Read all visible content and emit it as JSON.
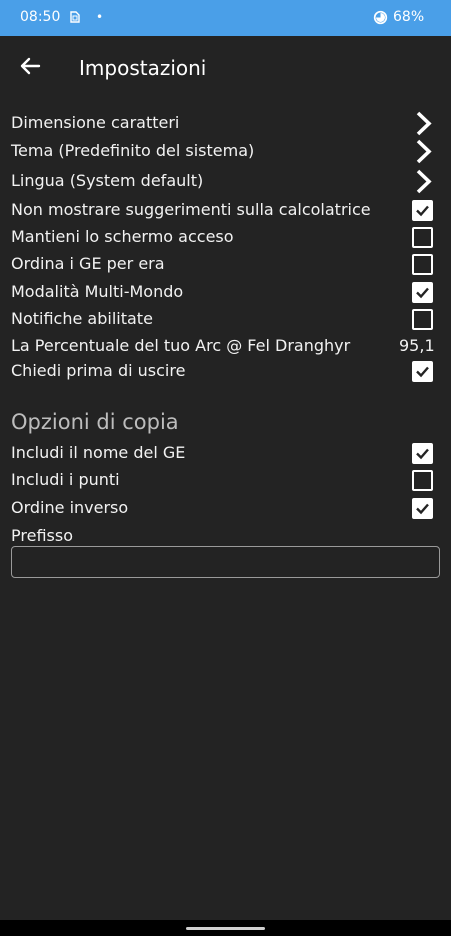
{
  "status_bar": {
    "time": "08:50",
    "dot": "•",
    "battery": "68%"
  },
  "app_bar": {
    "title": "Impostazioni",
    "back_icon": "arrow-left-icon"
  },
  "settings": [
    {
      "label": "Dimensione caratteri",
      "control": "chevron"
    },
    {
      "label": "Tema (Predefinito del sistema)",
      "control": "chevron"
    },
    {
      "label": "Lingua (System default)",
      "control": "chevron"
    },
    {
      "label": "Non mostrare suggerimenti sulla calcolatrice",
      "control": "checkbox",
      "checked": true
    },
    {
      "label": "Mantieni lo schermo acceso",
      "control": "checkbox",
      "checked": false
    },
    {
      "label": "Ordina i GE per era",
      "control": "checkbox",
      "checked": false
    },
    {
      "label": "Modalità Multi-Mondo",
      "control": "checkbox",
      "checked": true
    },
    {
      "label": "Notifiche abilitate",
      "control": "checkbox",
      "checked": false
    },
    {
      "label": "La Percentuale del tuo Arc @ Fel Dranghyr",
      "control": "value",
      "value": "95,1"
    },
    {
      "label": "Chiedi prima di uscire",
      "control": "checkbox",
      "checked": true
    }
  ],
  "copy_options": {
    "title": "Opzioni di copia",
    "items": [
      {
        "label": "Includi il nome del GE",
        "checked": true
      },
      {
        "label": "Includi i punti",
        "checked": false
      },
      {
        "label": "Ordine inverso",
        "checked": true
      }
    ],
    "prefix_label": "Prefisso",
    "prefix_value": ""
  },
  "colors": {
    "status_bar": "#4a9fe8",
    "background": "#232323",
    "text": "#f2f2f2",
    "section_title": "#bdbdbd"
  }
}
